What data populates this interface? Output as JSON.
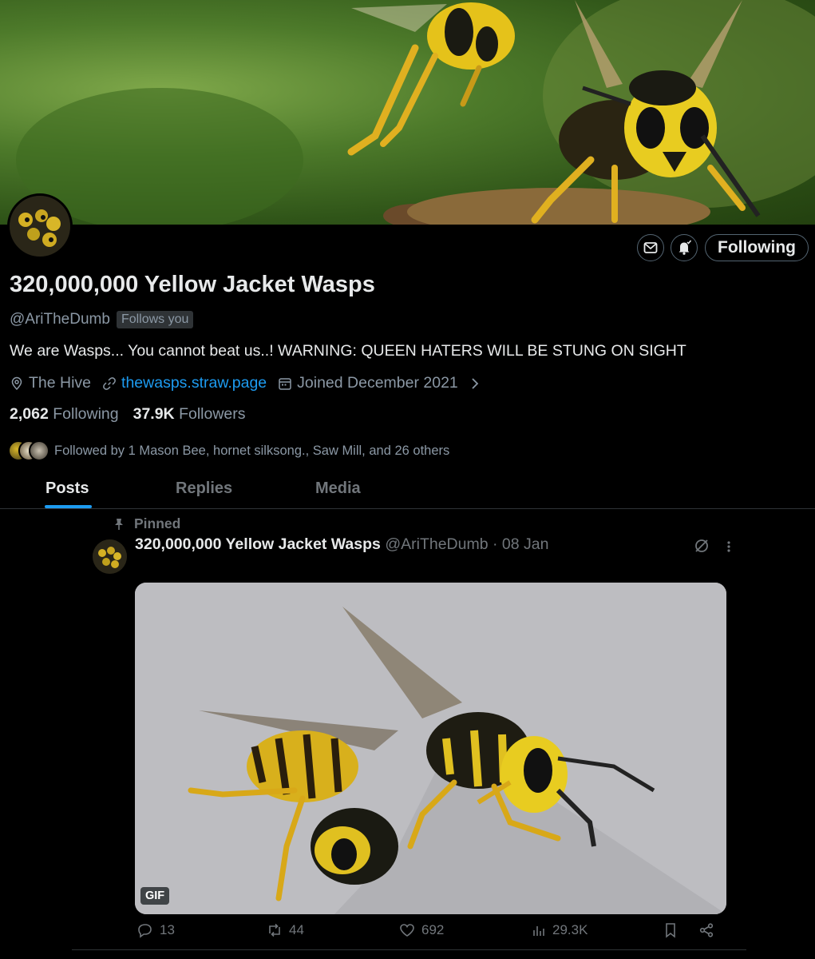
{
  "profile": {
    "display_name": "320,000,000 Yellow Jacket Wasps",
    "handle": "@AriTheDumb",
    "follows_you": "Follows you",
    "bio": "We are Wasps... You cannot beat us..!  WARNING: QUEEN HATERS WILL BE STUNG ON SIGHT",
    "location": "The Hive",
    "website": "thewasps.straw.page",
    "joined": "Joined December 2021",
    "following_count": "2,062",
    "following_label": "Following",
    "followers_count": "37.9K",
    "followers_label": "Followers",
    "followed_by": "Followed by 1 Mason Bee, hornet silksong., Saw Mill, and 26 others"
  },
  "header_actions": {
    "message_icon": "envelope-icon",
    "notify_icon": "bell-check-icon",
    "following_button": "Following"
  },
  "tabs": [
    "Posts",
    "Replies",
    "Media"
  ],
  "pinned_post": {
    "pinned_label": "Pinned",
    "author_name": "320,000,000 Yellow Jacket Wasps",
    "author_handle": "@AriTheDumb",
    "date": "· 08 Jan",
    "media_badge": "GIF",
    "replies": "13",
    "reposts": "44",
    "likes": "692",
    "views": "29.3K"
  },
  "colors": {
    "background": "#000000",
    "accent": "#1d9bf0",
    "text_primary": "#e7e9ea",
    "text_secondary": "#71767b"
  }
}
